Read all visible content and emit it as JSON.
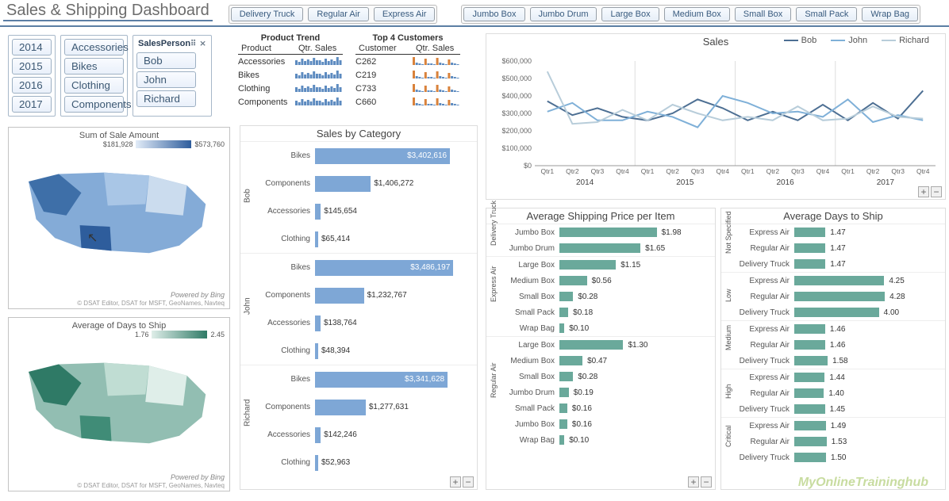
{
  "title": "Sales & Shipping Dashboard",
  "slicer_ship_mode": [
    "Delivery Truck",
    "Regular Air",
    "Express Air"
  ],
  "slicer_container": [
    "Jumbo Box",
    "Jumbo Drum",
    "Large Box",
    "Medium Box",
    "Small Box",
    "Small Pack",
    "Wrap Bag"
  ],
  "slicer_year": [
    "2014",
    "2015",
    "2016",
    "2017"
  ],
  "slicer_category": [
    "Accessories",
    "Bikes",
    "Clothing",
    "Components"
  ],
  "slicer_person_header": "SalesPerson",
  "slicer_person": [
    "Bob",
    "John",
    "Richard"
  ],
  "product_trend": {
    "title": "Product Trend",
    "col_a": "Product",
    "col_b": "Qtr. Sales",
    "rows": [
      "Accessories",
      "Bikes",
      "Clothing",
      "Components"
    ]
  },
  "top_customers": {
    "title": "Top 4 Customers",
    "col_a": "Customer",
    "col_b": "Qtr. Sales",
    "rows": [
      "C262",
      "C219",
      "C733",
      "C660"
    ]
  },
  "map1": {
    "title": "Sum of Sale Amount",
    "legend_min": "$181,928",
    "legend_max": "$573,760",
    "powered": "Powered by Bing",
    "attrib": "© DSAT Editor, DSAT for MSFT, GeoNames, Navteq"
  },
  "map2": {
    "title": "Average of Days to Ship",
    "legend_min": "1.76",
    "legend_max": "2.45",
    "powered": "Powered by Bing",
    "attrib": "© DSAT Editor, DSAT for MSFT, GeoNames, Navteq"
  },
  "sales_by_category_title": "Sales by Category",
  "avg_ship_price_title": "Average Shipping Price per Item",
  "avg_days_title": "Average Days to Ship",
  "sales_chart_title": "Sales",
  "watermark": "MyOnlineTraininghub",
  "chart_data": [
    {
      "id": "sales_by_category",
      "type": "bar",
      "orientation": "h",
      "group_field": "SalesPerson",
      "categories": [
        "Bikes",
        "Components",
        "Accessories",
        "Clothing"
      ],
      "groups": [
        {
          "name": "Bob",
          "values": [
            3402616,
            1406272,
            145654,
            65414
          ],
          "labels": [
            "$3,402,616",
            "$1,406,272",
            "$145,654",
            "$65,414"
          ]
        },
        {
          "name": "John",
          "values": [
            3486197,
            1232767,
            138764,
            48394
          ],
          "labels": [
            "$3,486,197",
            "$1,232,767",
            "$138,764",
            "$48,394"
          ]
        },
        {
          "name": "Richard",
          "values": [
            3341628,
            1277631,
            142246,
            52963
          ],
          "labels": [
            "$3,341,628",
            "$1,277,631",
            "$142,246",
            "$52,963"
          ]
        }
      ],
      "max": 3600000,
      "bar_color": "#7ea7d6"
    },
    {
      "id": "sales_line",
      "type": "line",
      "title": "Sales",
      "x": [
        "Qtr1",
        "Qtr2",
        "Qtr3",
        "Qtr4",
        "Qtr1",
        "Qtr2",
        "Qtr3",
        "Qtr4",
        "Qtr1",
        "Qtr2",
        "Qtr3",
        "Qtr4",
        "Qtr1",
        "Qtr2",
        "Qtr3",
        "Qtr4"
      ],
      "x_groups": [
        "2014",
        "2015",
        "2016",
        "2017"
      ],
      "yticks": [
        "$0",
        "$100,000",
        "$200,000",
        "$300,000",
        "$400,000",
        "$500,000",
        "$600,000"
      ],
      "ylim": [
        0,
        600000
      ],
      "series": [
        {
          "name": "Bob",
          "color": "#4d6f93",
          "values": [
            370000,
            290000,
            330000,
            280000,
            260000,
            300000,
            380000,
            330000,
            260000,
            310000,
            260000,
            350000,
            260000,
            360000,
            270000,
            430000
          ]
        },
        {
          "name": "John",
          "color": "#7fb0d8",
          "values": [
            310000,
            360000,
            260000,
            260000,
            310000,
            280000,
            220000,
            400000,
            360000,
            300000,
            310000,
            280000,
            380000,
            250000,
            290000,
            260000
          ]
        },
        {
          "name": "Richard",
          "color": "#b8cdda",
          "values": [
            540000,
            240000,
            250000,
            320000,
            260000,
            350000,
            300000,
            260000,
            280000,
            260000,
            340000,
            260000,
            270000,
            340000,
            280000,
            270000
          ]
        }
      ]
    },
    {
      "id": "avg_shipping_price",
      "type": "bar",
      "orientation": "h",
      "max": 2.1,
      "bar_color": "#6aa99b",
      "groups": [
        {
          "name": "Delivery Truck",
          "items": [
            {
              "label": "Jumbo Box",
              "value": 1.98,
              "disp": "$1.98"
            },
            {
              "label": "Jumbo Drum",
              "value": 1.65,
              "disp": "$1.65"
            }
          ]
        },
        {
          "name": "Express Air",
          "items": [
            {
              "label": "Large Box",
              "value": 1.15,
              "disp": "$1.15"
            },
            {
              "label": "Medium Box",
              "value": 0.56,
              "disp": "$0.56"
            },
            {
              "label": "Small Box",
              "value": 0.28,
              "disp": "$0.28"
            },
            {
              "label": "Small Pack",
              "value": 0.18,
              "disp": "$0.18"
            },
            {
              "label": "Wrap Bag",
              "value": 0.1,
              "disp": "$0.10"
            }
          ]
        },
        {
          "name": "Regular Air",
          "items": [
            {
              "label": "Large Box",
              "value": 1.3,
              "disp": "$1.30"
            },
            {
              "label": "Medium Box",
              "value": 0.47,
              "disp": "$0.47"
            },
            {
              "label": "Small Box",
              "value": 0.28,
              "disp": "$0.28"
            },
            {
              "label": "Jumbo Drum",
              "value": 0.19,
              "disp": "$0.19"
            },
            {
              "label": "Small Pack",
              "value": 0.16,
              "disp": "$0.16"
            },
            {
              "label": "Jumbo Box",
              "value": 0.16,
              "disp": "$0.16"
            },
            {
              "label": "Wrap Bag",
              "value": 0.1,
              "disp": "$0.10"
            }
          ]
        }
      ]
    },
    {
      "id": "avg_days_to_ship",
      "type": "bar",
      "orientation": "h",
      "max": 4.5,
      "bar_color": "#6aa99b",
      "groups": [
        {
          "name": "Not Specified",
          "items": [
            {
              "label": "Express Air",
              "value": 1.47,
              "disp": "1.47"
            },
            {
              "label": "Regular Air",
              "value": 1.47,
              "disp": "1.47"
            },
            {
              "label": "Delivery Truck",
              "value": 1.47,
              "disp": "1.47"
            }
          ]
        },
        {
          "name": "Low",
          "items": [
            {
              "label": "Express Air",
              "value": 4.25,
              "disp": "4.25"
            },
            {
              "label": "Regular Air",
              "value": 4.28,
              "disp": "4.28"
            },
            {
              "label": "Delivery Truck",
              "value": 4.0,
              "disp": "4.00"
            }
          ]
        },
        {
          "name": "Medium",
          "items": [
            {
              "label": "Express Air",
              "value": 1.46,
              "disp": "1.46"
            },
            {
              "label": "Regular Air",
              "value": 1.46,
              "disp": "1.46"
            },
            {
              "label": "Delivery Truck",
              "value": 1.58,
              "disp": "1.58"
            }
          ]
        },
        {
          "name": "High",
          "items": [
            {
              "label": "Express Air",
              "value": 1.44,
              "disp": "1.44"
            },
            {
              "label": "Regular Air",
              "value": 1.4,
              "disp": "1.40"
            },
            {
              "label": "Delivery Truck",
              "value": 1.45,
              "disp": "1.45"
            }
          ]
        },
        {
          "name": "Critical",
          "items": [
            {
              "label": "Express Air",
              "value": 1.49,
              "disp": "1.49"
            },
            {
              "label": "Regular Air",
              "value": 1.53,
              "disp": "1.53"
            },
            {
              "label": "Delivery Truck",
              "value": 1.5,
              "disp": "1.50"
            }
          ]
        }
      ]
    }
  ]
}
